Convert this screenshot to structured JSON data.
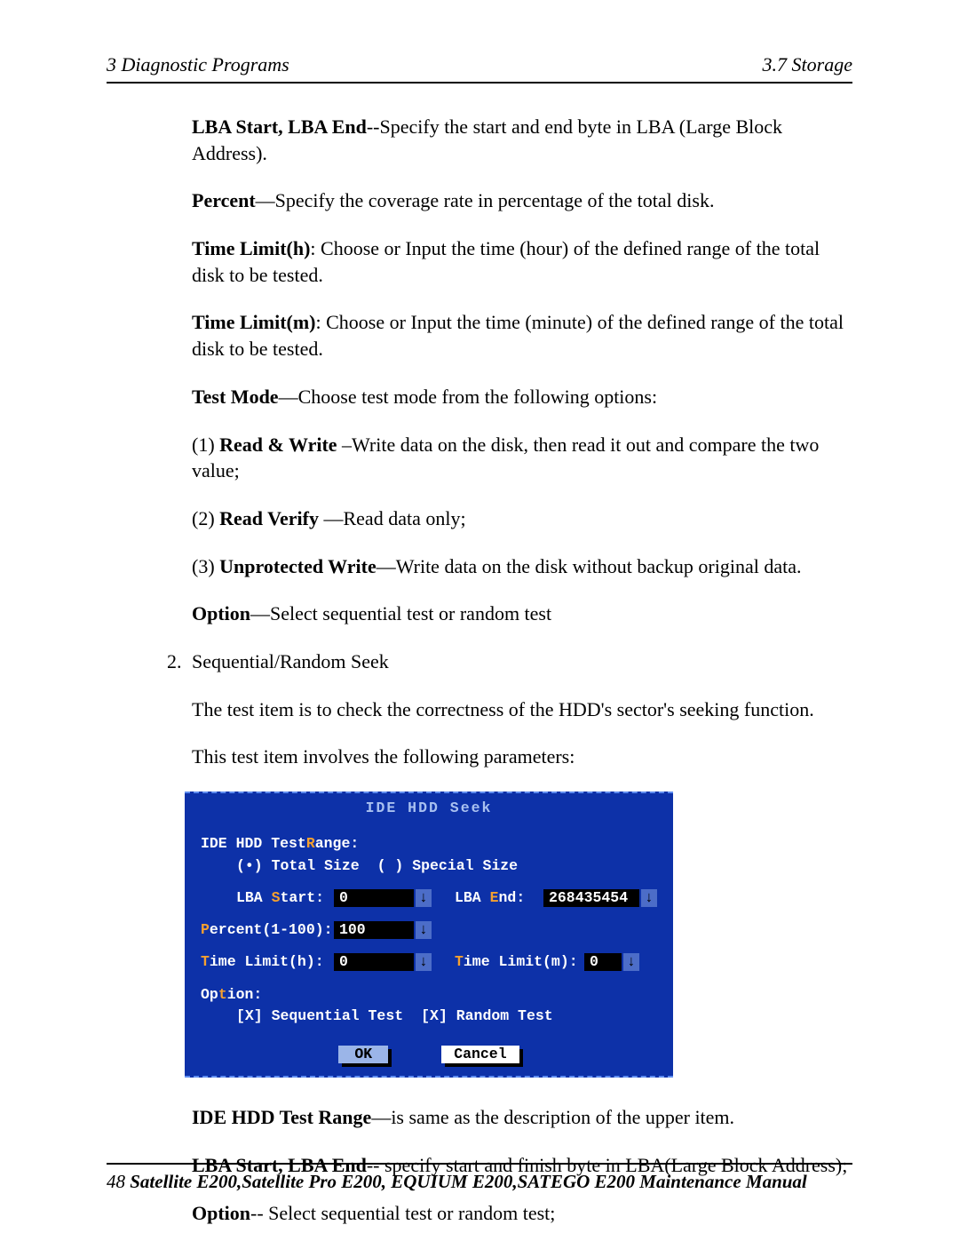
{
  "header": {
    "left": "3  Diagnostic Programs",
    "right": "3.7 Storage"
  },
  "p1": {
    "term": "LBA Start, LBA End",
    "rest": "--Specify the start and end byte in LBA (Large Block Address)."
  },
  "p2": {
    "term": "Percent",
    "rest": "—Specify the coverage rate in percentage of the total disk."
  },
  "p3": {
    "term": "Time Limit(h)",
    "rest": ": Choose or Input the time (hour) of the defined range of the total disk to be tested."
  },
  "p4": {
    "term": "Time Limit(m)",
    "rest": ": Choose or Input the time (minute) of the defined range of the total disk to be tested."
  },
  "p5": {
    "term": "Test Mode",
    "rest": "—Choose test mode from the following options:"
  },
  "p6": {
    "pre": "(1) ",
    "term": "Read & Write",
    "rest": " –Write data on the disk, then read it out and compare the two value;"
  },
  "p7": {
    "pre": "(2) ",
    "term": "Read Verify",
    "rest": " —Read data only;"
  },
  "p8": {
    "pre": "(3) ",
    "term": "Unprotected Write",
    "rest": "—Write data on the disk without backup original data."
  },
  "p9": {
    "term": "Option",
    "rest": "—Select sequential test or random test"
  },
  "list2": {
    "num": "2.",
    "text": "Sequential/Random Seek"
  },
  "p10": "The test item is to check the correctness of the HDD's sector's seeking function.",
  "p11": "This test item involves the following parameters:",
  "dialog": {
    "title": "IDE HDD Seek",
    "rangeLabel_pre": "IDE HDD Test ",
    "rangeLabel_hot": "R",
    "rangeLabel_post": "ange:",
    "totalSize": "(•) Total Size",
    "specialSize": "( ) Special Size",
    "lbaStart_pre": "LBA ",
    "lbaStart_hot": "S",
    "lbaStart_post": "tart:",
    "lbaStartVal": "0",
    "lbaEnd_pre": "LBA ",
    "lbaEnd_hot": "E",
    "lbaEnd_post": "nd:",
    "lbaEndVal": "268435454",
    "percent_hot": "P",
    "percent_post": "ercent(1-100):",
    "percentVal": "100",
    "timeh_hot": "T",
    "timeh_post": "ime Limit(h):",
    "timehVal": "0",
    "timem_hot": "T",
    "timem_post": "ime Limit(m):",
    "timemVal": "0",
    "option_pre": "Op",
    "option_hot": "t",
    "option_post": "ion:",
    "seqTest": "[X] Sequential Test",
    "randTest": "[X] Random Test",
    "ok": "OK",
    "cancel": "Cancel"
  },
  "p12": {
    "term": "IDE HDD Test Range",
    "rest": "—is same as the description  of  the upper item."
  },
  "p13": {
    "term": "LBA Start, LBA End",
    "rest": "-- specify start and finish byte in LBA(Large Block Address);"
  },
  "p14": {
    "term": "Option",
    "rest": "-- Select sequential test or random test;"
  },
  "footer": {
    "pgnum": "48",
    "title": " Satellite E200,Satellite Pro E200, EQUIUM E200,SATEGO E200 Maintenance Manual"
  }
}
